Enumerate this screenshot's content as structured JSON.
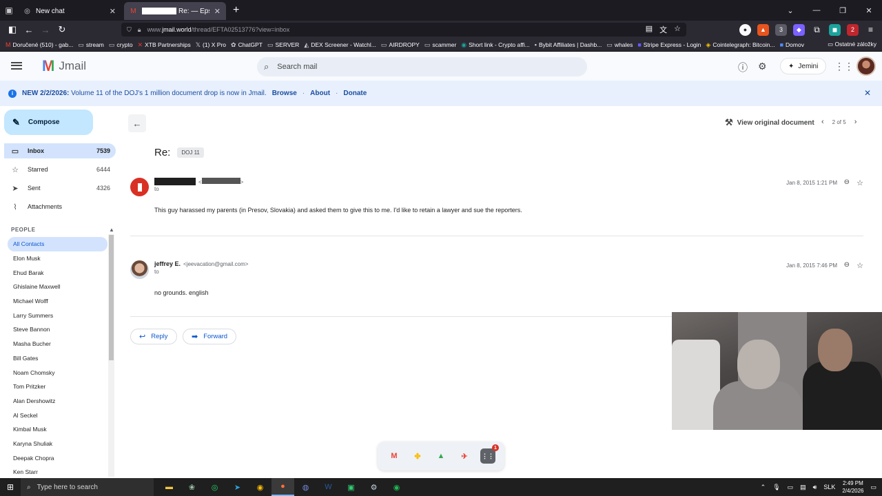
{
  "browser": {
    "tabs": [
      {
        "title": "New chat",
        "active": false
      },
      {
        "title": "Re: — Epstein E",
        "active": true
      }
    ],
    "url": {
      "prefix": "www.",
      "domain": "jmail.world",
      "path": "/thread/EFTA02513776?view=inbox"
    },
    "bookmarks": [
      {
        "label": "Doručené (510) - gab...",
        "icon": "gmail-icon"
      },
      {
        "label": "stream",
        "icon": "folder-icon"
      },
      {
        "label": "crypto",
        "icon": "folder-icon"
      },
      {
        "label": "XTB Partnerships",
        "icon": "xtb-icon"
      },
      {
        "label": "(1) X Pro",
        "icon": "x-icon"
      },
      {
        "label": "ChatGPT",
        "icon": "chatgpt-icon"
      },
      {
        "label": "SERVER",
        "icon": "folder-icon"
      },
      {
        "label": "DEX Screener - Watchl...",
        "icon": "dex-icon"
      },
      {
        "label": "AIRDROPY",
        "icon": "folder-icon"
      },
      {
        "label": "scammer",
        "icon": "folder-icon"
      },
      {
        "label": "Short link - Crypto affi...",
        "icon": "link-icon"
      },
      {
        "label": "Bybit Affiliates | Dashb...",
        "icon": "bybit-icon"
      },
      {
        "label": "whales",
        "icon": "folder-icon"
      },
      {
        "label": "Stripe Express - Login",
        "icon": "stripe-icon"
      },
      {
        "label": "Cointelegraph: Bitcoin...",
        "icon": "cointelegraph-icon"
      },
      {
        "label": "Domov",
        "icon": "home-icon"
      }
    ],
    "bookmarks_other": "Ostatné záložky"
  },
  "app": {
    "name": "Jmail",
    "search_placeholder": "Search mail",
    "assistant_label": "Jemini"
  },
  "banner": {
    "headline": "NEW 2/2/2026:",
    "text": "Volume 11 of the DOJ's 1 million document drop is now in Jmail.",
    "links": [
      "Browse",
      "About",
      "Donate"
    ]
  },
  "sidebar": {
    "compose_label": "Compose",
    "items": [
      {
        "label": "Inbox",
        "count": "7539",
        "icon": "inbox-icon",
        "active": true
      },
      {
        "label": "Starred",
        "count": "6444",
        "icon": "star-icon",
        "active": false
      },
      {
        "label": "Sent",
        "count": "4326",
        "icon": "send-icon",
        "active": false
      },
      {
        "label": "Attachments",
        "count": "",
        "icon": "paperclip-icon",
        "active": false
      }
    ],
    "people_header": "PEOPLE",
    "people": [
      "All Contacts",
      "Elon Musk",
      "Ehud Barak",
      "Ghislaine Maxwell",
      "Michael Wolff",
      "Larry Summers",
      "Steve Bannon",
      "Masha Bucher",
      "Bill Gates",
      "Noam Chomsky",
      "Tom Pritzker",
      "Alan Dershowitz",
      "Al Seckel",
      "Kimbal Musk",
      "Karyna Shuliak",
      "Deepak Chopra",
      "Ken Starr"
    ]
  },
  "thread": {
    "view_original_label": "View original document",
    "pager": "2 of 5",
    "subject": "Re:",
    "tag": "DOJ 11",
    "messages": [
      {
        "sender_name": "",
        "sender_email": "",
        "redacted": true,
        "to_label": "to",
        "date": "Jan 8, 2015 1:21 PM",
        "body": "This guy harassed my parents (in Presov, Slovakia) and asked them to give this to me. I'd like to retain a lawyer and sue the reporters."
      },
      {
        "sender_name": "jeffrey E.",
        "sender_email": "<jeevacation@gmail.com>",
        "redacted": false,
        "to_label": "to",
        "date": "Jan 8, 2015 7:46 PM",
        "body": "no grounds. english"
      }
    ],
    "reply_label": "Reply",
    "forward_label": "Forward"
  },
  "dock": {
    "badge": "1"
  },
  "taskbar": {
    "search_placeholder": "Type here to search",
    "language": "SLK",
    "time": "2:49 PM",
    "date": "2/4/2026"
  },
  "colors": {
    "compose_bg": "#c2e7ff",
    "active_nav": "#d3e3fd",
    "banner_bg": "#e8f0fe",
    "link_blue": "#0b57d0",
    "sender_avatar_red": "#d93025"
  }
}
